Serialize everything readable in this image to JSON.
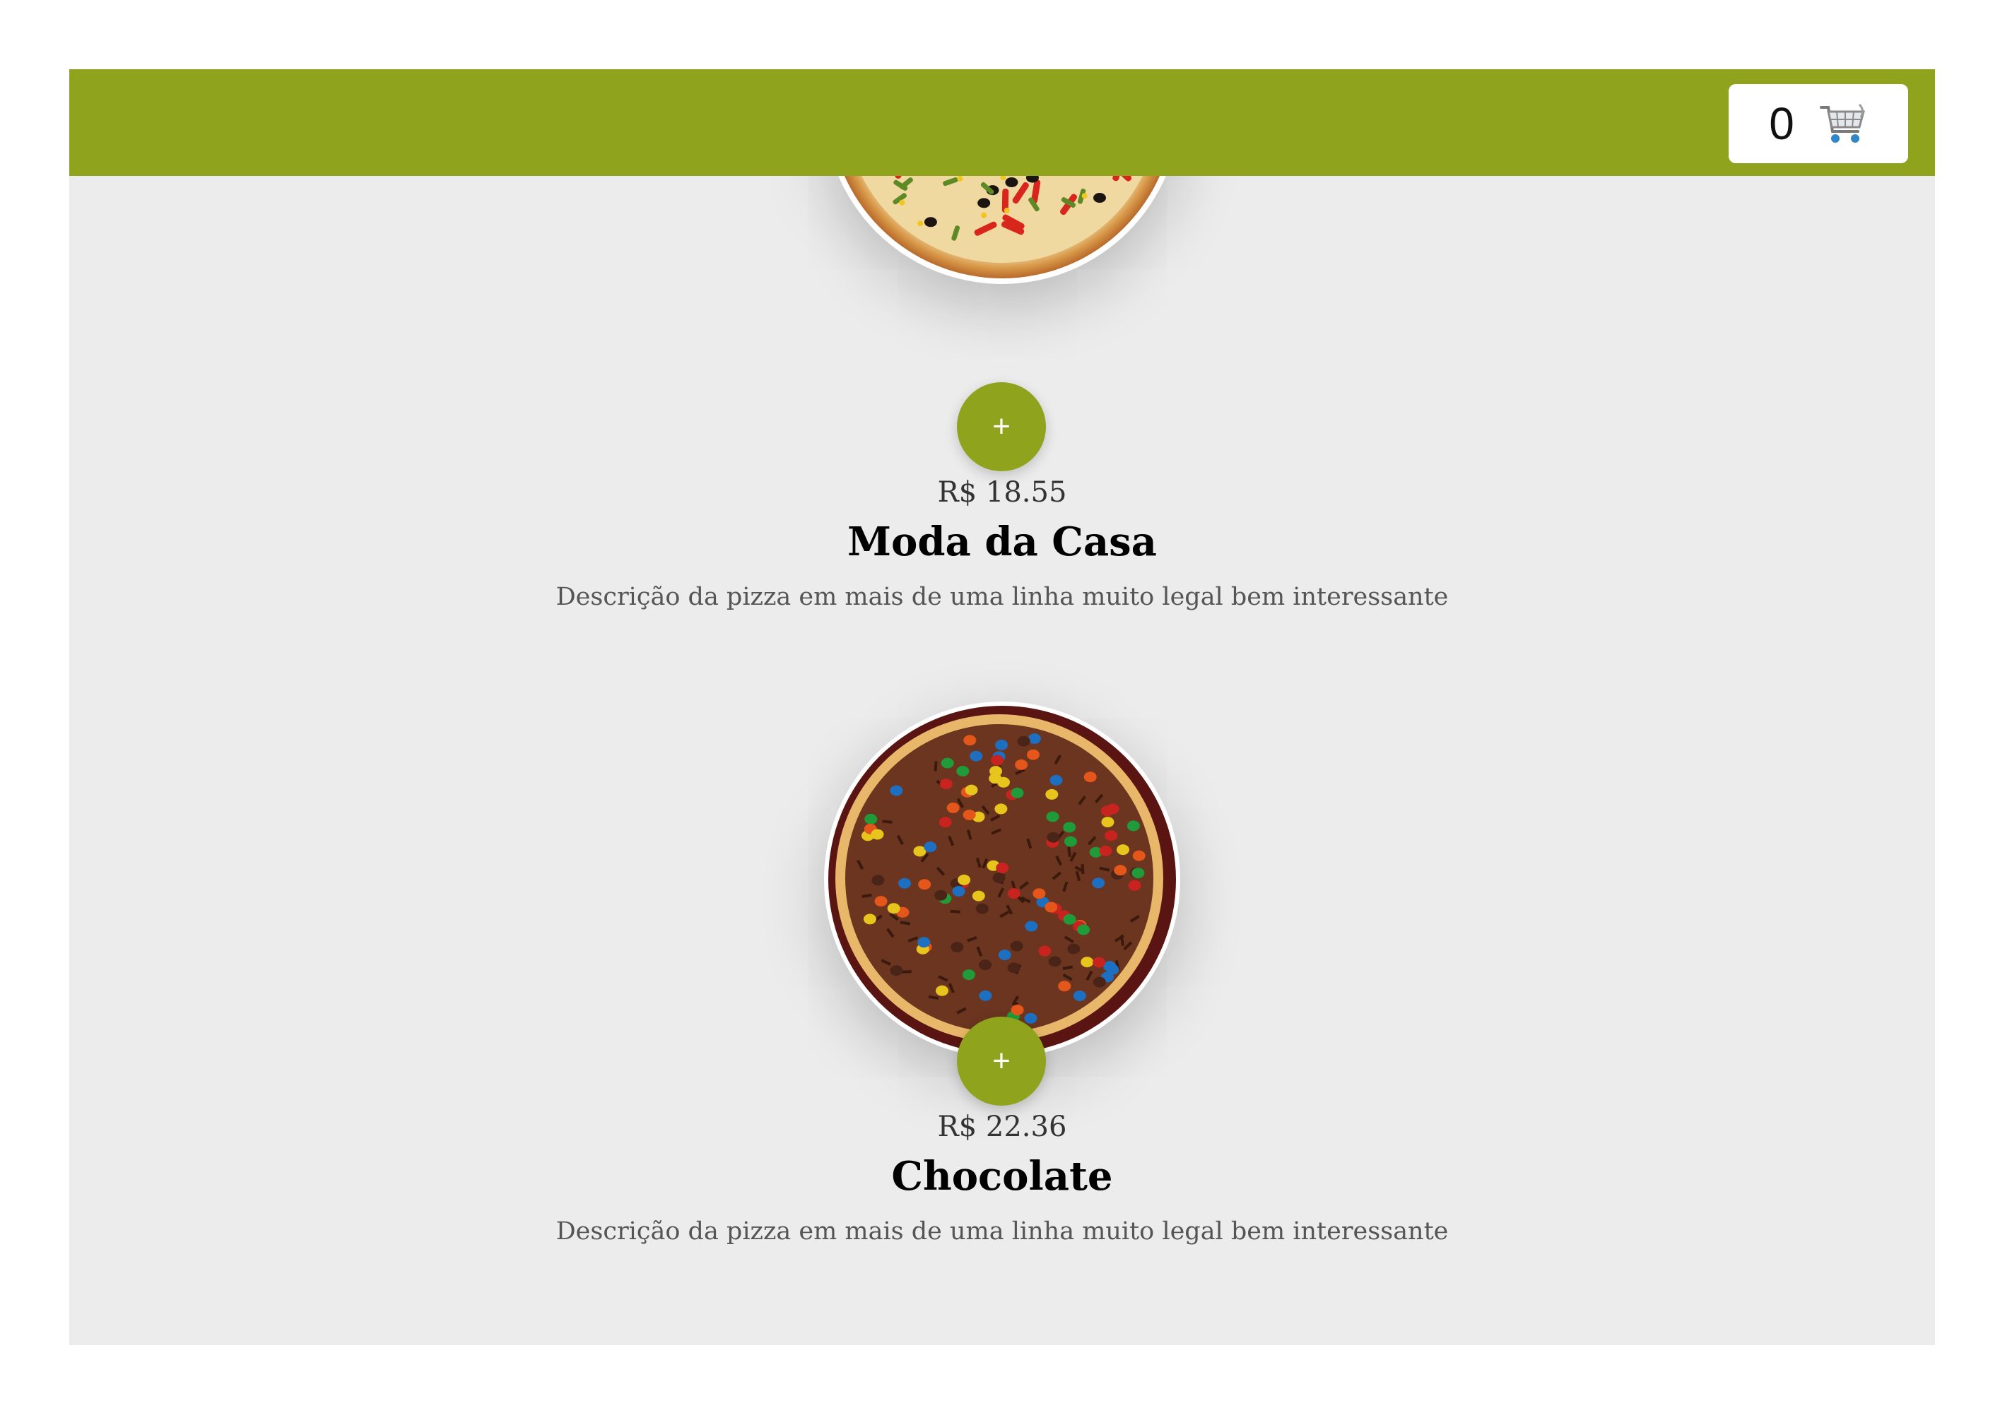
{
  "header": {
    "background_color": "#8fa31d",
    "cart": {
      "count": "0",
      "icon": "shopping-cart-icon"
    }
  },
  "products": [
    {
      "id": "moda-da-casa",
      "price": "R$ 18.55",
      "name": "Moda da Casa",
      "description": "Descrição da pizza em mais de uma linha muito legal bem interessante",
      "add_label": "+",
      "image": "vegetable-pizza-image"
    },
    {
      "id": "chocolate",
      "price": "R$ 22.36",
      "name": "Chocolate",
      "description": "Descrição da pizza em mais de uma linha muito legal bem interessante",
      "add_label": "+",
      "image": "chocolate-candy-pizza-image"
    }
  ],
  "colors": {
    "accent": "#8fa31d",
    "page_background": "#ececec"
  }
}
